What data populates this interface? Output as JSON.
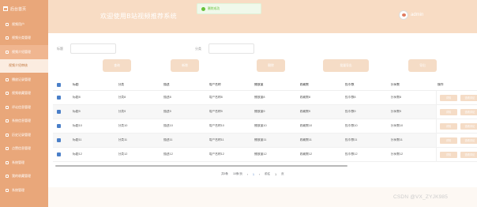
{
  "app": {
    "title": "欢迎使用B站视频推荐系统",
    "user": "admin"
  },
  "toast": {
    "message": "删除成功"
  },
  "sidebar": {
    "header": "后台首页",
    "items": [
      {
        "label": "视频用户",
        "state": "normal"
      },
      {
        "label": "视频分类管理",
        "state": "normal"
      },
      {
        "label": "视频介绍管理",
        "state": "active"
      },
      {
        "label": "视频介绍审核",
        "state": "sub"
      },
      {
        "label": "播放记录管理",
        "state": "normal"
      },
      {
        "label": "视频收藏管理",
        "state": "normal"
      },
      {
        "label": "评论信息管理",
        "state": "normal"
      },
      {
        "label": "系统信息管理",
        "state": "normal"
      },
      {
        "label": "历史记录管理",
        "state": "normal"
      },
      {
        "label": "点赞信息管理",
        "state": "normal"
      },
      {
        "label": "系统管理",
        "state": "normal"
      },
      {
        "label": "我的收藏管理",
        "state": "normal"
      },
      {
        "label": "系统管理",
        "state": "normal"
      }
    ]
  },
  "filters": {
    "title_label": "标题",
    "category_label": "分类",
    "buttons": [
      "查询",
      "新增",
      "删除",
      "批量导出",
      "导出"
    ]
  },
  "table": {
    "columns": [
      "标题",
      "分类",
      "描述",
      "用户名称",
      "播放量",
      "收藏数",
      "投币数",
      "分享数",
      "操作"
    ],
    "rows": [
      [
        "标题8",
        "分类8",
        "描述8",
        "用户名称8",
        "播放量8",
        "收藏数8",
        "投币数8",
        "分享数8"
      ],
      [
        "标题9",
        "分类9",
        "描述9",
        "用户名称9",
        "播放量9",
        "收藏数9",
        "投币数9",
        "分享数9"
      ],
      [
        "标题10",
        "分类10",
        "描述10",
        "用户名称10",
        "播放量10",
        "收藏数10",
        "投币数10",
        "分享数10"
      ],
      [
        "标题11",
        "分类11",
        "描述11",
        "用户名称11",
        "播放量11",
        "收藏数11",
        "投币数11",
        "分享数11"
      ],
      [
        "标题12",
        "分类12",
        "描述12",
        "用户名称12",
        "播放量12",
        "收藏数12",
        "投币数12",
        "分享数12"
      ]
    ],
    "op_labels": [
      "详情",
      "查看评论"
    ]
  },
  "pager": {
    "total": "共5条",
    "page_size": "10条/页",
    "current": "1",
    "goto": "前往",
    "goto_value": "1",
    "page_unit": "页"
  },
  "watermark": "CSDN @VX_ZYJK985",
  "colors": {
    "sidebar": "#e9a77a",
    "header": "#f8dcc4",
    "button": "#f5dcc6",
    "checkbox": "#4a7fc8"
  }
}
